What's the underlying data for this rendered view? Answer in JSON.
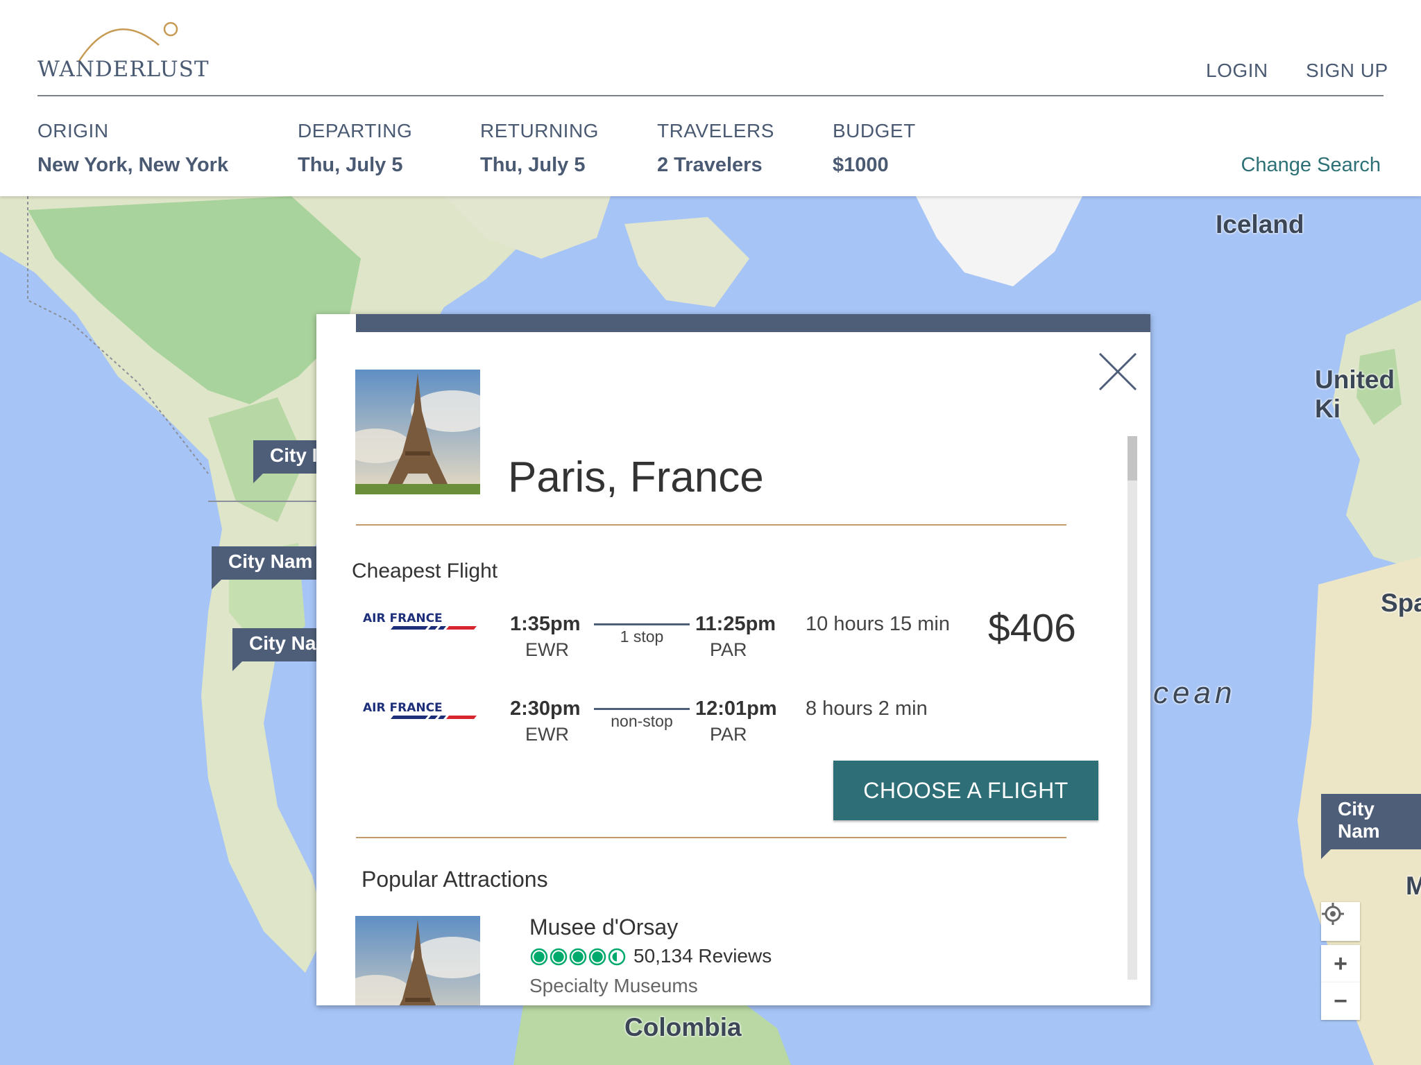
{
  "brand": {
    "name": "WANDERLUST"
  },
  "auth": {
    "login": "LOGIN",
    "signup": "SIGN UP"
  },
  "search": {
    "origin": {
      "label": "ORIGIN",
      "value": "New York, New York"
    },
    "departing": {
      "label": "DEPARTING",
      "value": "Thu, July 5"
    },
    "returning": {
      "label": "RETURNING",
      "value": "Thu, July 5"
    },
    "travelers": {
      "label": "TRAVELERS",
      "value": "2 Travelers"
    },
    "budget": {
      "label": "BUDGET",
      "value": "$1000"
    },
    "change_search": "Change Search"
  },
  "map": {
    "labels": [
      "Iceland",
      "United Ki",
      "Spa",
      "cean",
      "Colombia",
      "M"
    ],
    "city_tags": [
      "City I",
      "City Nam",
      "City Na",
      "City Nam"
    ],
    "controls": {
      "locate": "locate-icon",
      "zoom_in": "+",
      "zoom_out": "−"
    }
  },
  "modal": {
    "destination": "Paris, France",
    "cheapest_flight_title": "Cheapest Flight",
    "flights": [
      {
        "airline": "AIR FRANCE",
        "depart_time": "1:35pm",
        "depart_code": "EWR",
        "stops": "1 stop",
        "arrive_time": "11:25pm",
        "arrive_code": "PAR",
        "duration": "10 hours 15 min"
      },
      {
        "airline": "AIR FRANCE",
        "depart_time": "2:30pm",
        "depart_code": "EWR",
        "stops": "non-stop",
        "arrive_time": "12:01pm",
        "arrive_code": "PAR",
        "duration": "8 hours 2 min"
      }
    ],
    "price": "$406",
    "choose_button": "CHOOSE A FLIGHT",
    "attractions_title": "Popular Attractions",
    "attractions": [
      {
        "name": "Musee d'Orsay",
        "rating": 4.5,
        "reviews": "50,134 Reviews",
        "category": "Specialty Museums"
      }
    ]
  },
  "colors": {
    "brand_blue": "#4f5e78",
    "accent_teal": "#2d6e77",
    "divider_tan": "#c49a6c",
    "rating_green": "#00aa6c"
  }
}
